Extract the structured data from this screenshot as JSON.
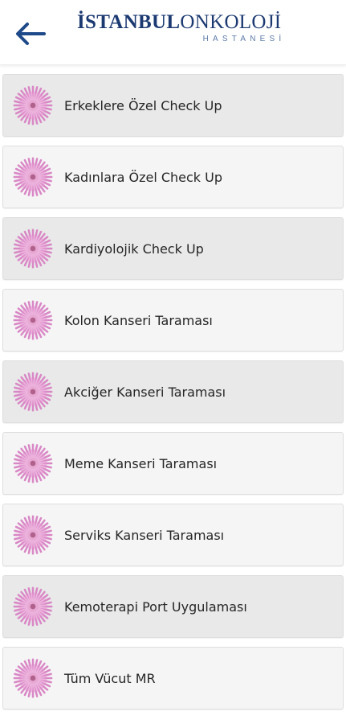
{
  "header": {
    "back_icon": "arrow-left-icon",
    "logo_bold": "İSTANBUL",
    "logo_regular": "ONKOLOJİ",
    "logo_sub": "HASTANESİ"
  },
  "menu": {
    "items": [
      {
        "label": "Erkeklere Özel Check Up",
        "icon": "flower-icon",
        "style": "dark"
      },
      {
        "label": "Kadınlara Özel Check Up",
        "icon": "flower-icon",
        "style": "light"
      },
      {
        "label": "Kardiyolojik Check Up",
        "icon": "flower-icon",
        "style": "dark"
      },
      {
        "label": "Kolon Kanseri Taraması",
        "icon": "flower-icon",
        "style": "light"
      },
      {
        "label": "Akciğer Kanseri Taraması",
        "icon": "flower-icon",
        "style": "dark"
      },
      {
        "label": "Meme Kanseri Taraması",
        "icon": "flower-icon",
        "style": "light"
      },
      {
        "label": "Serviks Kanseri Taraması",
        "icon": "flower-icon",
        "style": "light"
      },
      {
        "label": "Kemoterapi Port Uygulaması",
        "icon": "flower-icon",
        "style": "dark"
      },
      {
        "label": "Tüm Vücut MR",
        "icon": "flower-icon",
        "style": "light"
      }
    ]
  },
  "colors": {
    "brand_blue": "#1c3a72",
    "back_arrow": "#1f4a8a",
    "flower_petal": "#d988c6",
    "flower_center": "#b0628c"
  }
}
